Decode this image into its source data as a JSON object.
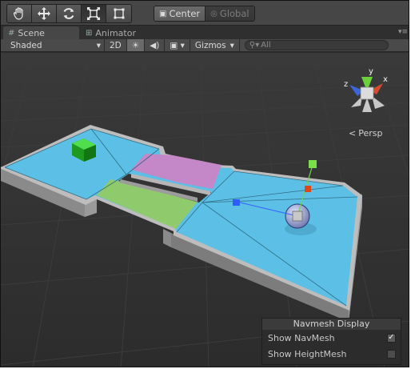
{
  "toolbar": {
    "tools": [
      {
        "name": "hand-tool",
        "icon": "hand-icon",
        "active": false
      },
      {
        "name": "move-tool",
        "icon": "move-arrows-icon",
        "active": false
      },
      {
        "name": "rotate-tool",
        "icon": "rotate-icon",
        "active": false
      },
      {
        "name": "scale-tool",
        "icon": "scale-icon",
        "active": true
      },
      {
        "name": "rect-tool",
        "icon": "rect-icon",
        "active": false
      }
    ],
    "pivot": {
      "center_label": "Center",
      "global_label": "Global"
    }
  },
  "tabs": [
    {
      "label": "Scene",
      "icon": "scene-icon",
      "active": true
    },
    {
      "label": "Animator",
      "icon": "animator-icon",
      "active": false
    }
  ],
  "scene_options": {
    "shading": "Shaded",
    "mode_2d": "2D",
    "lighting_icon": "sun-icon",
    "audio_icon": "speaker-icon",
    "effects_icon": "image-icon",
    "gizmos_label": "Gizmos",
    "search_placeholder": "All"
  },
  "viewport": {
    "persp_label": "Persp",
    "gizmo_axes": {
      "x": "x",
      "y": "y",
      "z": "z"
    },
    "colors": {
      "navmesh": "#5bbfe6",
      "area_purple": "#c487c8",
      "area_green": "#8fcb6d",
      "cube": "#22bb22",
      "grid_background": "#2f2f2f"
    }
  },
  "navmesh_display": {
    "title": "Navmesh Display",
    "show_navmesh_label": "Show NavMesh",
    "show_navmesh_checked": true,
    "show_heightmesh_label": "Show HeightMesh",
    "show_heightmesh_checked": false
  }
}
